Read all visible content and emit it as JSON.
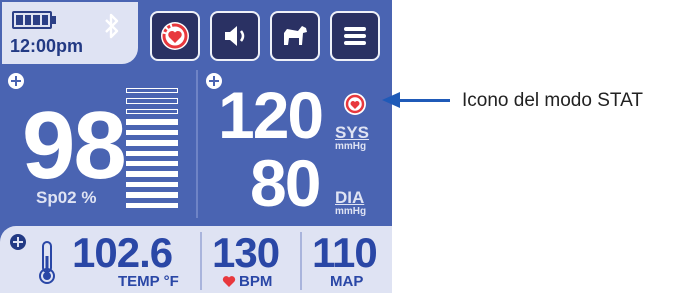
{
  "status": {
    "time": "12:00pm",
    "battery_icon": "battery-full-icon",
    "bluetooth_icon": "bluetooth-icon"
  },
  "toolbar": [
    {
      "icon": "stat-mode-icon"
    },
    {
      "icon": "speaker-icon"
    },
    {
      "icon": "dog-icon"
    },
    {
      "icon": "menu-icon"
    }
  ],
  "spo2": {
    "value": "98",
    "label": "Sp02 %"
  },
  "bp": {
    "systolic": "120",
    "sys_label": "SYS",
    "sys_unit": "mmHg",
    "diastolic": "80",
    "dia_label": "DIA",
    "dia_unit": "mmHg"
  },
  "temp": {
    "value": "102.6",
    "label": "TEMP °F"
  },
  "pulse": {
    "value": "130",
    "label": "BPM"
  },
  "map": {
    "value": "110",
    "label": "MAP"
  },
  "callout": {
    "text": "Icono del modo STAT"
  },
  "colors": {
    "screen": "#4a64b2",
    "panel_light": "#dfe3f3",
    "button": "#2a3163",
    "stat_red": "#e8383d",
    "accent_blue": "#2a47a6"
  }
}
